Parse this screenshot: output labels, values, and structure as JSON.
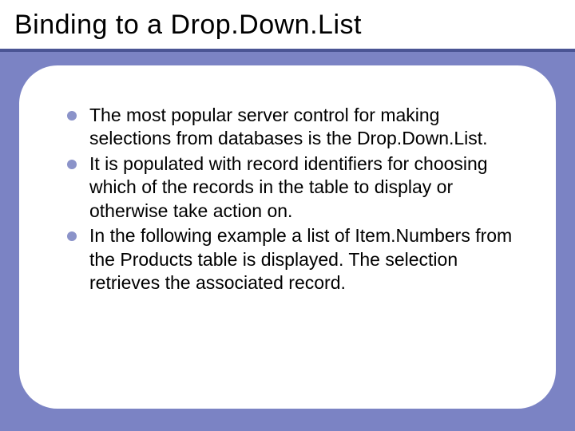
{
  "title": "Binding to a Drop.Down.List",
  "bullets": [
    "The most popular server control for making selections from databases is the Drop.Down.List.",
    "It is populated with record identifiers for choosing which of the records in the table to display or otherwise take action on.",
    "In the following example a list of Item.Numbers from the Products table is displayed. The selection retrieves the associated record."
  ]
}
